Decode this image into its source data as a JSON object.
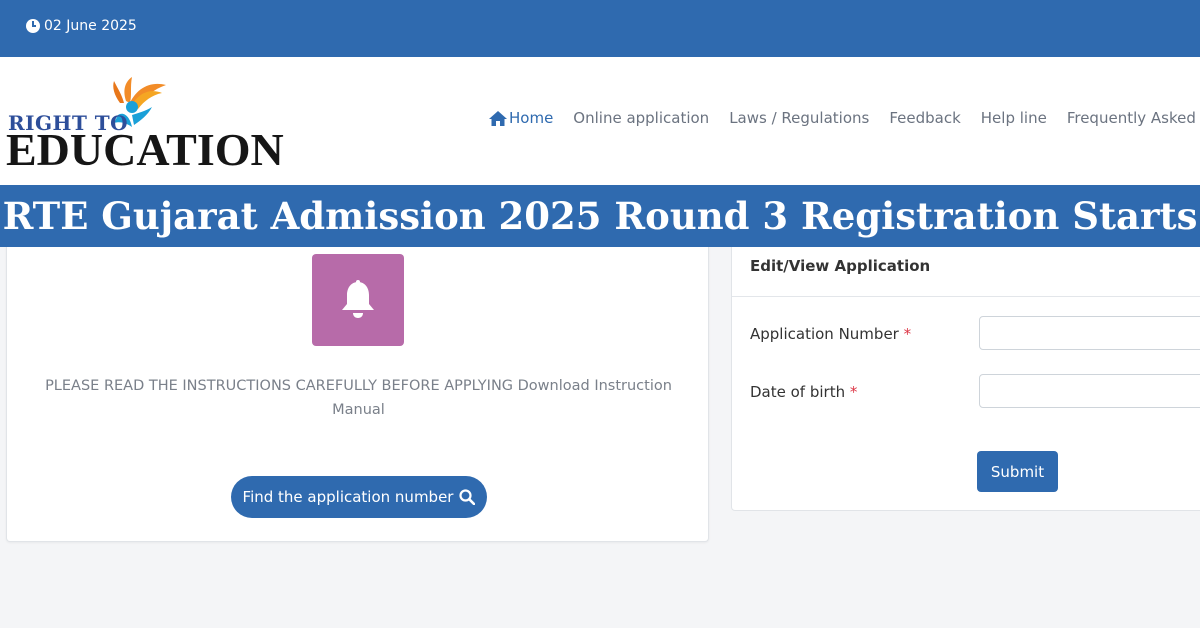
{
  "topbar": {
    "date": "02 June 2025",
    "icon": "clock-icon"
  },
  "logo": {
    "line1": "RIGHT TO",
    "line2": "EDUCATION"
  },
  "nav": {
    "home": "Home",
    "online_application": "Online application",
    "laws": "Laws / Regulations",
    "feedback": "Feedback",
    "helpline": "Help line",
    "faq": "Frequently Asked Qu"
  },
  "banner": {
    "title": "RTE Gujarat Admission 2025 Round 3 Registration Starts"
  },
  "left_card": {
    "instructions": "PLEASE READ THE INSTRUCTIONS CAREFULLY BEFORE APPLYING Download Instruction Manual",
    "find_button": "Find the application number"
  },
  "right_card": {
    "title": "Edit/View Application",
    "application_number_label": "Application Number",
    "dob_label": "Date of birth",
    "required_mark": "*",
    "submit_label": "Submit"
  },
  "colors": {
    "primary": "#2f6aaf",
    "bell_bg": "#b76ba9",
    "required": "#dc3545"
  }
}
